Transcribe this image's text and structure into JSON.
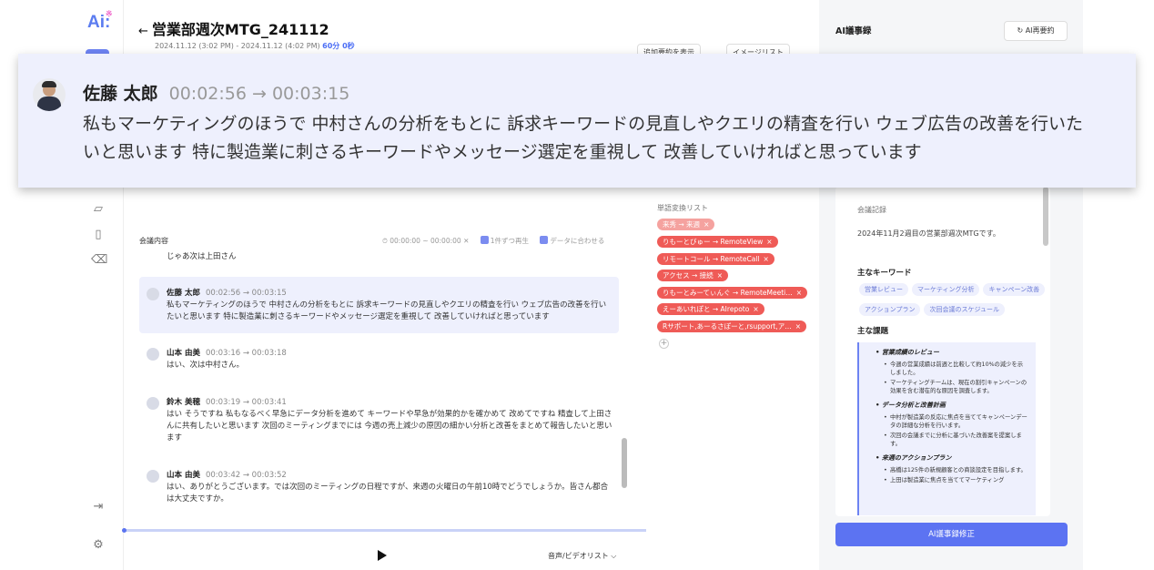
{
  "app": {
    "logo": "Ai:"
  },
  "header": {
    "back": "←",
    "title": "営業部週次MTG_241112",
    "date": "2024.11.12 (3:02 PM) - 2024.11.12 (4:02 PM)",
    "duration": "60分 0秒",
    "btn_show_add": "追加要約を表示",
    "btn_image_list": "イメージリスト"
  },
  "transcript_panel": {
    "heading": "会議内容",
    "range": "00:00:00 ~ 00:00:00",
    "opt_one": "1件ずつ再生",
    "opt_fit": "データに合わせる",
    "media_list": "音声/ビデオリスト ⌵",
    "entries": [
      {
        "name": "",
        "time": "",
        "text": "じゃあ次は上田さん"
      },
      {
        "name": "佐藤 太郎",
        "time": "00:02:56 → 00:03:15",
        "text": "私もマーケティングのほうで 中村さんの分析をもとに 訴求キーワードの見直しやクエリの精査を行い ウェブ広告の改善を行いたいと思います 特に製造業に刺さるキーワードやメッセージ選定を重視して 改善していければと思っています"
      },
      {
        "name": "山本 由美",
        "time": "00:03:16 → 00:03:18",
        "text": "はい、次は中村さん。"
      },
      {
        "name": "鈴木 美穂",
        "time": "00:03:19 → 00:03:41",
        "text": "はい そうですね 私もなるべく早急にデータ分析を進めて キーワードや早急が効果的かを確かめて 改めてですね 精査して上田さんに共有したいと思います 次回のミーティングまでには 今週の売上減少の原因の細かい分析と改善をまとめて報告したいと思います"
      },
      {
        "name": "山本 由美",
        "time": "00:03:42 → 00:03:52",
        "text": "はい、ありがとうございます。では次回のミーティングの日程ですが、来週の火曜日の午前10時でどうでしょうか。皆さん都合は大丈夫ですか。"
      }
    ]
  },
  "word_list": {
    "title": "単語変換リスト",
    "tags": [
      "来秀 → 来週",
      "りもーとびゅー → RemoteView",
      "リモートコール → RemoteCall",
      "アクセス → 接続",
      "りもーとみーてぃんぐ → RemoteMeeti…",
      "えーあいれぽと → AIrepoto",
      "Rサポート,あーるさぽーと,rsupport,ア…"
    ],
    "add": "+"
  },
  "ai_minutes": {
    "title": "AI議事録",
    "regen_button": "AI再要約",
    "record_heading": "会議記録",
    "record_text": "2024年11月2週目の営業部週次MTGです。",
    "keywords_heading": "主なキーワード",
    "keywords": [
      "営業レビュー",
      "マーケティング分析",
      "キャンペーン改善",
      "アクションプラン",
      "次回会議のスケジュール"
    ],
    "issues_heading": "主な課題",
    "issues": [
      {
        "title": "営業成績のレビュー",
        "items": [
          "今週の営業成績は前週と比較して約10%の減少を示しました。",
          "マーケティングチームは、現在の割引キャンペーンの効果を含む潜在的な原因を調査します。"
        ]
      },
      {
        "title": "データ分析と改善計画",
        "items": [
          "中村が製造業の反応に焦点を当ててキャンペーンデータの詳細な分析を行います。",
          "次回の会議までに分析に基づいた改善案を提案します。"
        ]
      },
      {
        "title": "来週のアクションプラン",
        "items": [
          "高橋は125件の新規顧客との商談設定を目指します。",
          "上田は製造業に焦点を当ててマーケティング"
        ]
      }
    ],
    "submit_button": "AI議事録修正"
  },
  "zoom": {
    "name": "佐藤 太郎",
    "time": "00:02:56 → 00:03:15",
    "text": "私もマーケティングのほうで 中村さんの分析をもとに 訴求キーワードの見直しやクエリの精査を行い ウェブ広告の改善を行いたいと思います 特に製造業に刺さるキーワードやメッセージ選定を重視して 改善していければと思っています"
  },
  "colors": {
    "accent": "#5c73f2",
    "tag": "#ef5b57",
    "selected_bg": "#eef0fd"
  }
}
